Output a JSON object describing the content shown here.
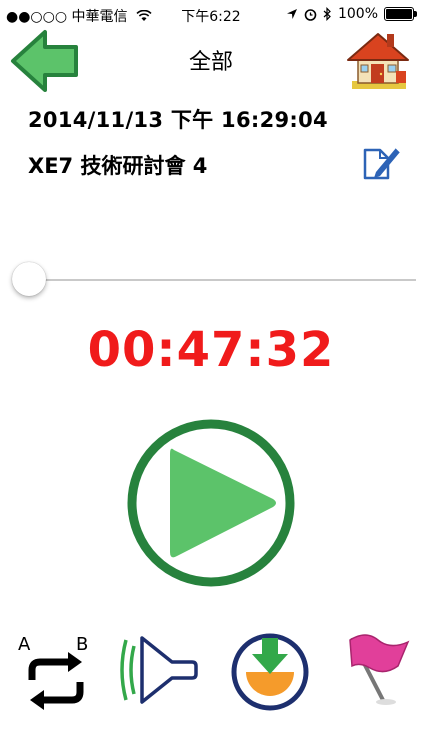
{
  "status_bar": {
    "carrier": "●●○○○ 中華電信",
    "time": "下午6:22",
    "battery": "100%"
  },
  "header": {
    "title": "全部"
  },
  "recording": {
    "datetime": "2014/11/13 下午 16:29:04",
    "name": "XE7 技術研討會 4"
  },
  "player": {
    "elapsed": "00:47:32",
    "progress": 0.0
  },
  "controls": {
    "ab_repeat": {
      "label_a": "A",
      "label_b": "B"
    }
  },
  "colors": {
    "accent_green": "#27823d",
    "play_green": "#5cc36a",
    "timer_red": "#f01b1b",
    "navy": "#1d2f6e"
  },
  "icons": [
    "back-arrow-icon",
    "home-icon",
    "edit-icon",
    "play-icon",
    "ab-repeat-icon",
    "speaker-icon",
    "download-icon",
    "flag-icon"
  ]
}
